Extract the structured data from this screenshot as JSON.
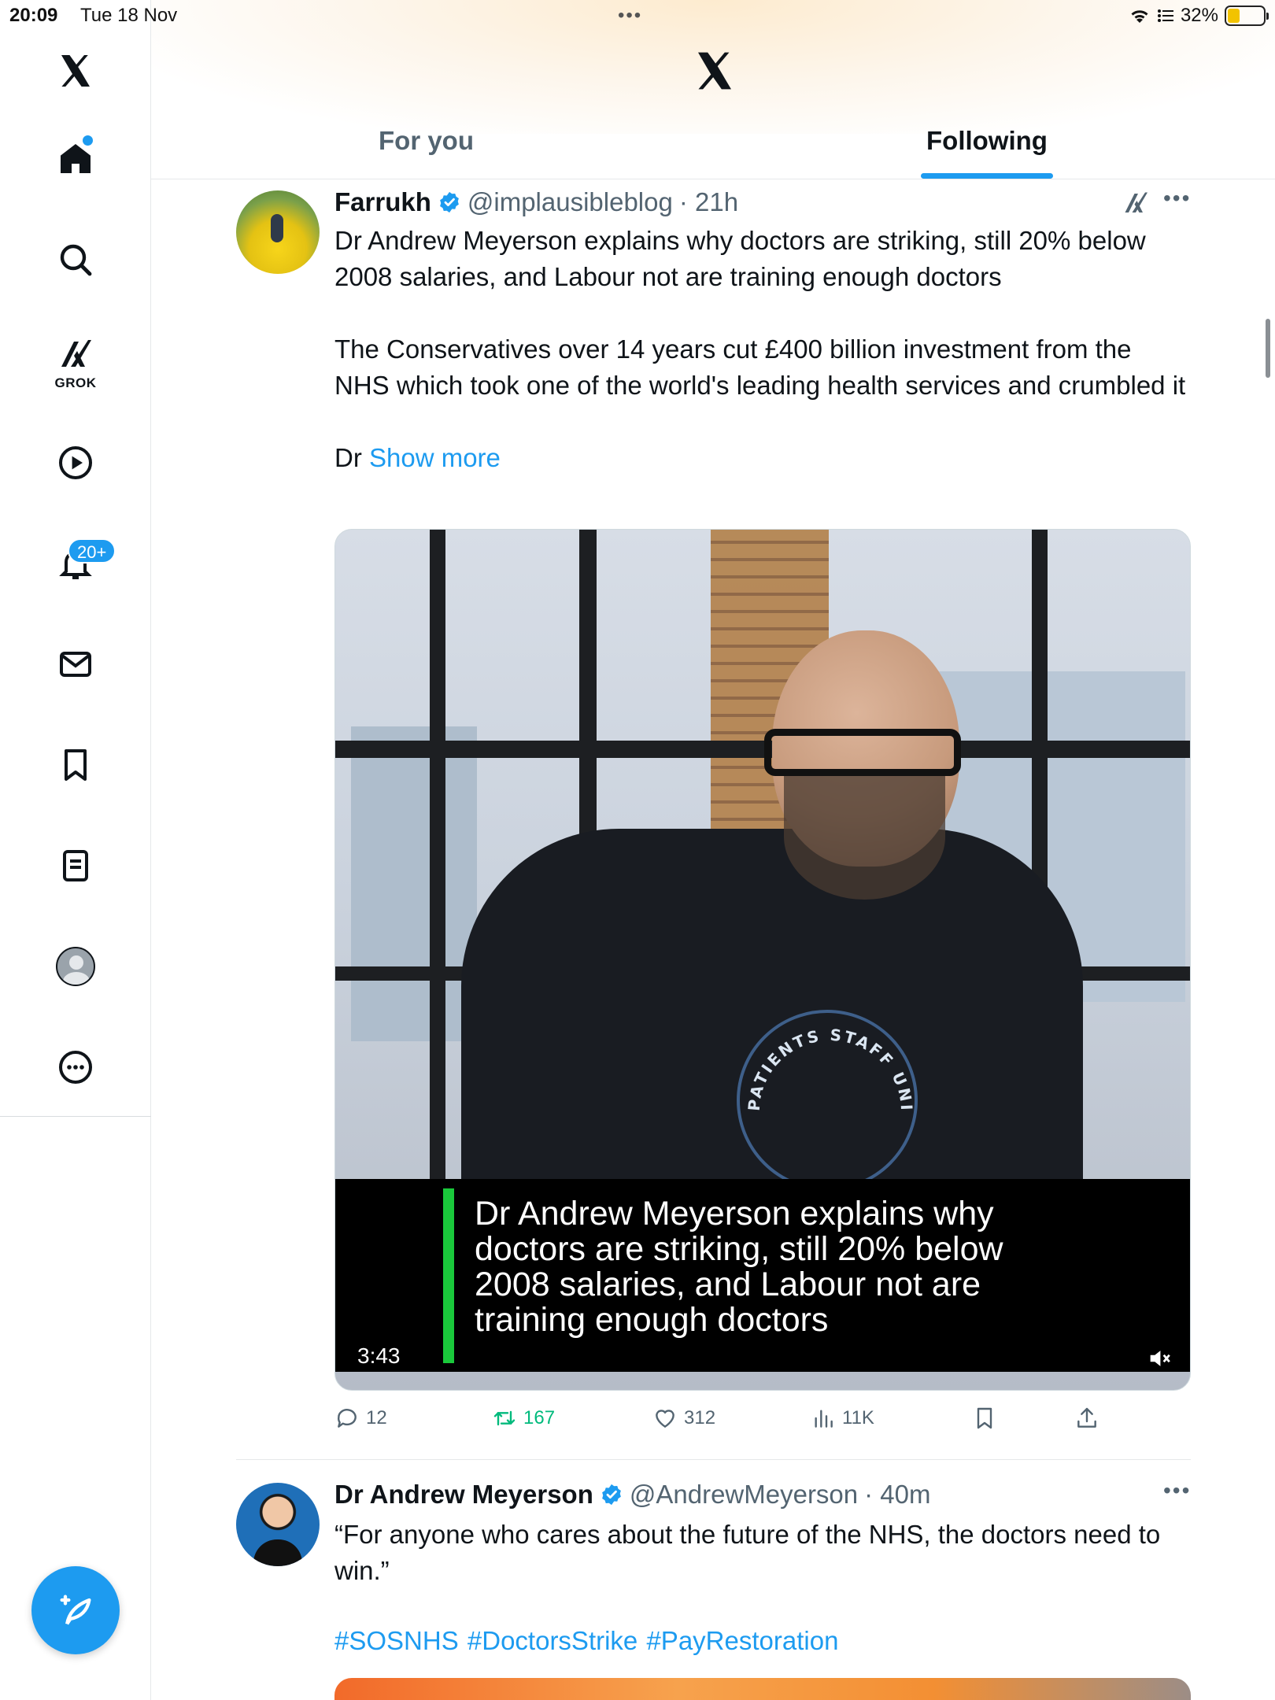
{
  "status_bar": {
    "time": "20:09",
    "date": "Tue 18 Nov",
    "battery": "32%"
  },
  "sidebar": {
    "grok_label": "GROK",
    "notifications_badge": "20+",
    "items": [
      {
        "icon": "x-logo-icon"
      },
      {
        "icon": "home-icon"
      },
      {
        "icon": "search-icon"
      },
      {
        "icon": "grok-icon"
      },
      {
        "icon": "play-icon"
      },
      {
        "icon": "bell-icon"
      },
      {
        "icon": "mail-icon"
      },
      {
        "icon": "bookmark-icon"
      },
      {
        "icon": "list-icon"
      },
      {
        "icon": "profile-icon"
      },
      {
        "icon": "more-circle-icon"
      }
    ]
  },
  "header": {
    "tabs": [
      {
        "label": "For you",
        "active": false
      },
      {
        "label": "Following",
        "active": true
      }
    ]
  },
  "tweets": [
    {
      "name": "Farrukh",
      "handle": "@implausibleblog",
      "time": "· 21h",
      "body_1": "Dr Andrew Meyerson explains why doctors are striking, still 20% below 2008 salaries, and Labour not are training enough doctors",
      "body_2": "The Conservatives over 14 years cut £400 billion investment from the NHS which took one of the world's leading health services and crumbled it",
      "body_3_prefix": "Dr ",
      "show_more": "Show more",
      "video": {
        "caption": "Dr Andrew Meyerson explains why doctors are striking, still 20% below 2008 salaries, and Labour not are training enough doctors",
        "duration": "3:43",
        "shirt_text": "PATIENTS STAFF UNITED FOR THE"
      },
      "actions": {
        "replies": "12",
        "retweets": "167",
        "likes": "312",
        "views": "11K"
      }
    },
    {
      "name": "Dr Andrew Meyerson",
      "handle": "@AndrewMeyerson",
      "time": "· 40m",
      "body_1": "“For anyone who cares about the future of the NHS, the doctors need to win.”",
      "hashtags": "#SOSNHS #DoctorsStrike #PayRestoration"
    }
  ],
  "colors": {
    "accent": "#1d9bf0",
    "retweet_green": "#00ba7c",
    "caption_bar_green": "#1ac93b",
    "text_primary": "#0f1419",
    "text_secondary": "#536471"
  }
}
